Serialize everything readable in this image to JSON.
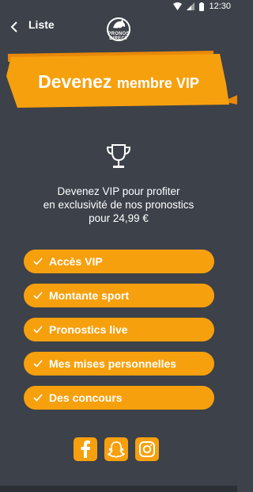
{
  "statusbar": {
    "time": "12:30"
  },
  "appbar": {
    "back_label": "Liste",
    "logo_text_1": "PRONOS",
    "logo_text_2": "DIRECT"
  },
  "banner": {
    "title_part1": "Devenez ",
    "title_part2": "membre VIP"
  },
  "description": {
    "line1": "Devenez VIP pour profiter",
    "line2": "en exclusivité de nos pronostics",
    "line3": "pour 24,99 €"
  },
  "features": [
    {
      "label": "Accès VIP"
    },
    {
      "label": "Montante sport"
    },
    {
      "label": "Pronostics live"
    },
    {
      "label": "Mes mises personnelles"
    },
    {
      "label": "Des concours"
    }
  ],
  "colors": {
    "background": "#3d4149",
    "accent": "#f7a00e",
    "banner_dark": "#e8890a"
  },
  "social": [
    "facebook-icon",
    "snapchat-icon",
    "instagram-icon"
  ]
}
